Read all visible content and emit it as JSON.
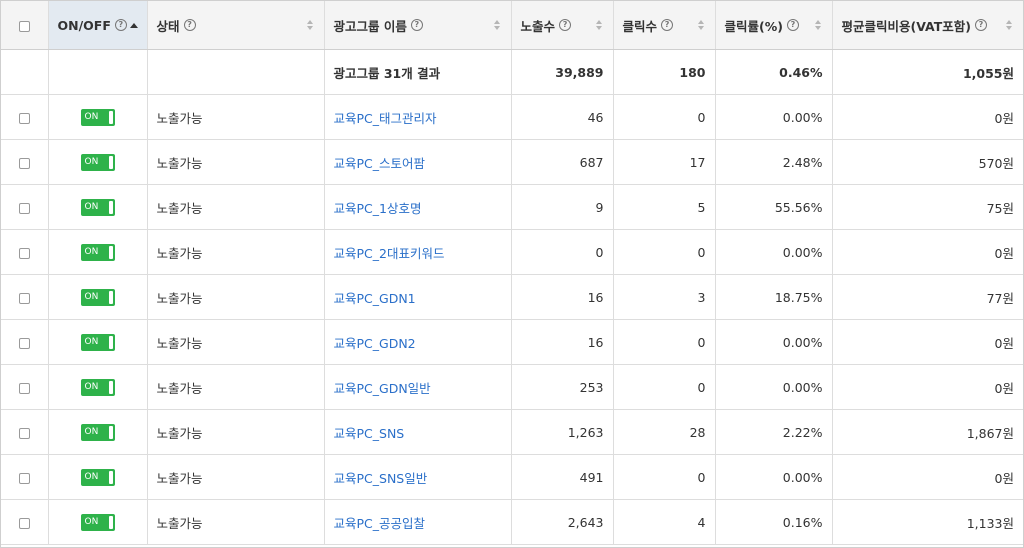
{
  "header": {
    "onoff": "ON/OFF",
    "status": "상태",
    "name": "광고그룹 이름",
    "impressions": "노출수",
    "clicks": "클릭수",
    "ctr": "클릭률(%)",
    "cpc": "평균클릭비용(VAT포함)"
  },
  "summary": {
    "name": "광고그룹 31개 결과",
    "impressions": "39,889",
    "clicks": "180",
    "ctr": "0.46%",
    "cpc": "1,055원"
  },
  "rows": [
    {
      "toggle": "ON",
      "status": "노출가능",
      "name": "교육PC_태그관리자",
      "impressions": "46",
      "clicks": "0",
      "ctr": "0.00%",
      "cpc": "0원"
    },
    {
      "toggle": "ON",
      "status": "노출가능",
      "name": "교육PC_스토어팜",
      "impressions": "687",
      "clicks": "17",
      "ctr": "2.48%",
      "cpc": "570원"
    },
    {
      "toggle": "ON",
      "status": "노출가능",
      "name": "교육PC_1상호명",
      "impressions": "9",
      "clicks": "5",
      "ctr": "55.56%",
      "cpc": "75원"
    },
    {
      "toggle": "ON",
      "status": "노출가능",
      "name": "교육PC_2대표키워드",
      "impressions": "0",
      "clicks": "0",
      "ctr": "0.00%",
      "cpc": "0원"
    },
    {
      "toggle": "ON",
      "status": "노출가능",
      "name": "교육PC_GDN1",
      "impressions": "16",
      "clicks": "3",
      "ctr": "18.75%",
      "cpc": "77원"
    },
    {
      "toggle": "ON",
      "status": "노출가능",
      "name": "교육PC_GDN2",
      "impressions": "16",
      "clicks": "0",
      "ctr": "0.00%",
      "cpc": "0원"
    },
    {
      "toggle": "ON",
      "status": "노출가능",
      "name": "교육PC_GDN일반",
      "impressions": "253",
      "clicks": "0",
      "ctr": "0.00%",
      "cpc": "0원"
    },
    {
      "toggle": "ON",
      "status": "노출가능",
      "name": "교육PC_SNS",
      "impressions": "1,263",
      "clicks": "28",
      "ctr": "2.22%",
      "cpc": "1,867원"
    },
    {
      "toggle": "ON",
      "status": "노출가능",
      "name": "교육PC_SNS일반",
      "impressions": "491",
      "clicks": "0",
      "ctr": "0.00%",
      "cpc": "0원"
    },
    {
      "toggle": "ON",
      "status": "노출가능",
      "name": "교육PC_공공입찰",
      "impressions": "2,643",
      "clicks": "4",
      "ctr": "0.16%",
      "cpc": "1,133원"
    }
  ],
  "icons": {
    "help": "question-circle-icon",
    "sort": "sort-arrows-icon",
    "sort_active": "sort-ascending-icon"
  },
  "colors": {
    "toggle_on": "#2eb24a",
    "link": "#2a6fc9",
    "sorted_header_bg": "#e3eaf1"
  }
}
